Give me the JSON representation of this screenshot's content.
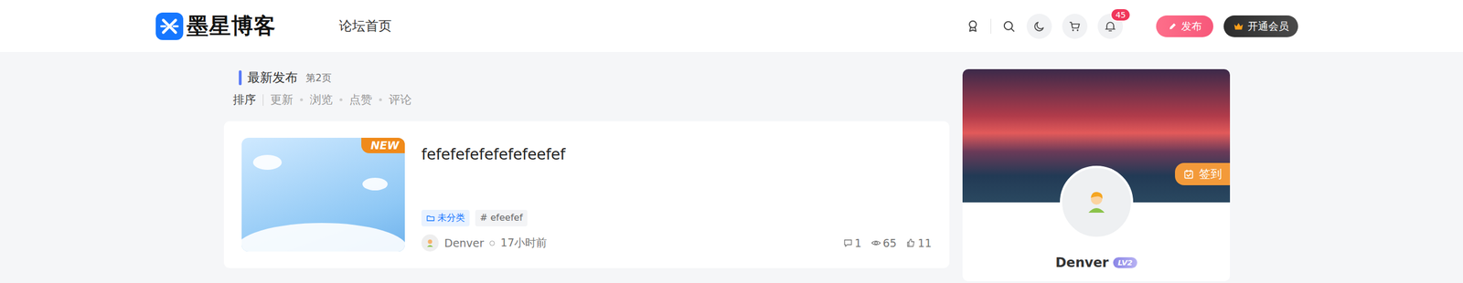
{
  "header": {
    "logo": "墨星博客",
    "nav": [
      {
        "label": "论坛首页",
        "selected": false
      }
    ],
    "notifications": "45",
    "publish": "发布",
    "vip": "开通会员"
  },
  "section": {
    "title": "最新发布",
    "page": "第2页",
    "sort_label": "排序",
    "sort_options": [
      {
        "label": "更新",
        "selected": false
      },
      {
        "label": "浏览",
        "selected": false
      },
      {
        "label": "点赞",
        "selected": false
      },
      {
        "label": "评论",
        "selected": false
      }
    ]
  },
  "posts": [
    {
      "title": "fefefefefefefefeefef",
      "badge": "NEW",
      "category": "未分类",
      "tags": [
        "# efeefef"
      ],
      "author": "Denver",
      "time": "17小时前",
      "comments": "1",
      "views": "65",
      "likes": "11"
    }
  ],
  "profile": {
    "name": "Denver",
    "level": "LV2",
    "checkin": "签到"
  }
}
